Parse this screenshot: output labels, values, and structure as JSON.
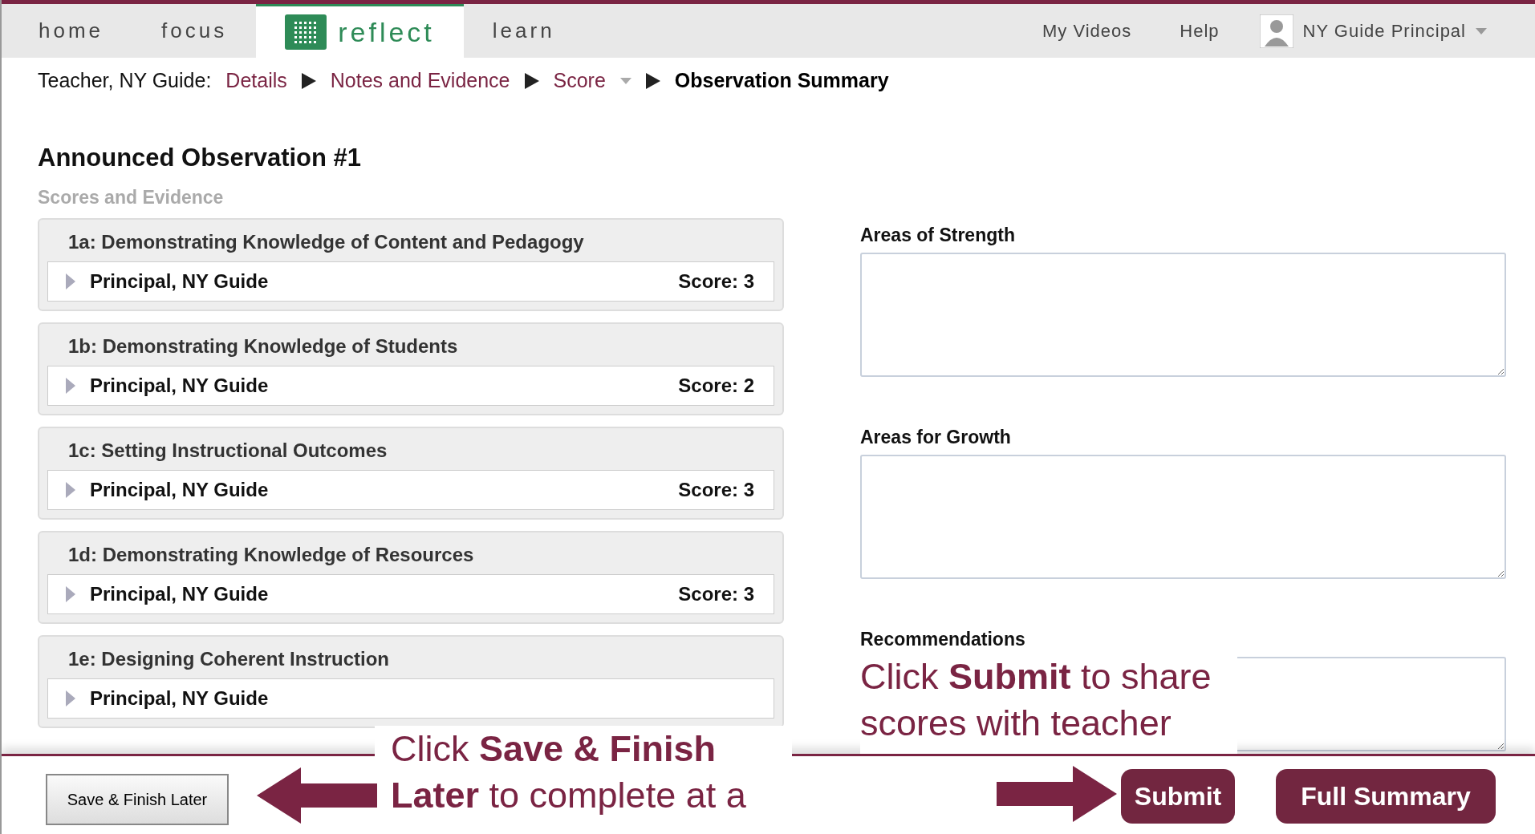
{
  "nav": {
    "tabs": [
      {
        "label": "home",
        "selected": false,
        "logo": false
      },
      {
        "label": "focus",
        "selected": false,
        "logo": false
      },
      {
        "label": "reflect",
        "selected": true,
        "logo": true
      },
      {
        "label": "learn",
        "selected": false,
        "logo": false
      }
    ],
    "links": [
      "My Videos",
      "Help"
    ],
    "user": "NY Guide Principal"
  },
  "breadcrumb": {
    "prefix": "Teacher, NY Guide:",
    "items": [
      {
        "label": "Details",
        "current": false,
        "dropdown": false
      },
      {
        "label": "Notes and Evidence",
        "current": false,
        "dropdown": false
      },
      {
        "label": "Score",
        "current": false,
        "dropdown": true
      },
      {
        "label": "Observation Summary",
        "current": true,
        "dropdown": false
      }
    ]
  },
  "title": "Announced Observation #1",
  "subtitle": "Scores and Evidence",
  "cards": [
    {
      "title": "1a: Demonstrating Knowledge of Content and Pedagogy",
      "reviewer": "Principal, NY Guide",
      "score": "Score: 3",
      "expanded": false
    },
    {
      "title": "1b: Demonstrating Knowledge of Students",
      "reviewer": "Principal, NY Guide",
      "score": "Score: 2",
      "expanded": false
    },
    {
      "title": "1c: Setting Instructional Outcomes",
      "reviewer": "Principal, NY Guide",
      "score": "Score: 3",
      "expanded": false
    },
    {
      "title": "1d: Demonstrating Knowledge of Resources",
      "reviewer": "Principal, NY Guide",
      "score": "Score: 3",
      "expanded": false
    },
    {
      "title": "1e: Designing Coherent Instruction",
      "reviewer": "Principal, NY Guide",
      "expanded": false
    }
  ],
  "fields": [
    {
      "label": "Areas of Strength"
    },
    {
      "label": "Areas for Growth"
    },
    {
      "label": "Recommendations"
    }
  ],
  "footer": {
    "save_later": "Save & Finish Later",
    "submit": "Submit",
    "full_summary": "Full Summary"
  },
  "callouts": [
    {
      "kind": "right",
      "text": "Click **Submit** to share scores with teacher"
    },
    {
      "kind": "left",
      "text": "Click **Save & Finish Later** to complete at a"
    }
  ]
}
